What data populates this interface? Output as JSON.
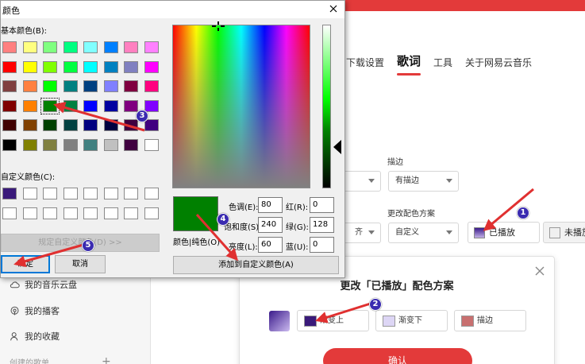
{
  "app": {
    "nav_tabs": [
      "下载设置",
      "歌词",
      "工具",
      "关于网易云音乐"
    ],
    "active_tab": "歌词",
    "stroke_label": "描边",
    "stroke_value": "有描边",
    "scheme_label": "更改配色方案",
    "scheme_value": "自定义",
    "played_label": "已播放",
    "unplayed_label": "未播放",
    "sidebar_items": [
      "我的音乐云盘",
      "我的播客",
      "我的收藏",
      "创建的歌单"
    ],
    "scheme_dialog": {
      "title": "更改「已播放」配色方案",
      "gradient_top": "渐变上",
      "gradient_bottom": "渐变下",
      "stroke": "描边",
      "confirm": "确认"
    }
  },
  "color_dialog": {
    "title": "颜色",
    "basic_label": "基本颜色(B):",
    "custom_label": "自定义颜色(C):",
    "define_custom_btn": "规定自定义颜色(D) >>",
    "ok_btn": "确定",
    "cancel_btn": "取消",
    "add_custom_btn": "添加到自定义颜色(A)",
    "preview_label": "颜色|纯色(O)",
    "fields": {
      "hue_label": "色调(E):",
      "hue": "80",
      "sat_label": "饱和度(S):",
      "sat": "240",
      "lum_label": "亮度(L):",
      "lum": "60",
      "red_label": "红(R):",
      "red": "0",
      "green_label": "绿(G):",
      "green": "128",
      "blue_label": "蓝(U):",
      "blue": "0"
    },
    "basic_colors": [
      [
        "#ff8080",
        "#ffff80",
        "#80ff80",
        "#00ff80",
        "#80ffff",
        "#0080ff",
        "#ff80c0",
        "#ff80ff"
      ],
      [
        "#ff0000",
        "#ffff00",
        "#80ff00",
        "#00ff40",
        "#00ffff",
        "#0080c0",
        "#8080c0",
        "#ff00ff"
      ],
      [
        "#804040",
        "#ff8040",
        "#00ff00",
        "#008080",
        "#004080",
        "#8080ff",
        "#800040",
        "#ff0080"
      ],
      [
        "#800000",
        "#ff8000",
        "#008000",
        "#008040",
        "#0000ff",
        "#0000a0",
        "#800080",
        "#8000ff"
      ],
      [
        "#400000",
        "#804000",
        "#004000",
        "#004040",
        "#000080",
        "#000040",
        "#400040",
        "#400080"
      ],
      [
        "#000000",
        "#808000",
        "#808040",
        "#808080",
        "#408080",
        "#c0c0c0",
        "#400040",
        "#ffffff"
      ]
    ],
    "selected_basic": [
      3,
      2
    ],
    "custom_colors": [
      [
        "#3a1a7a",
        "#ffffff",
        "#ffffff",
        "#ffffff",
        "#ffffff",
        "#ffffff",
        "#ffffff",
        "#ffffff"
      ],
      [
        "#ffffff",
        "#ffffff",
        "#ffffff",
        "#ffffff",
        "#ffffff",
        "#ffffff",
        "#ffffff",
        "#ffffff"
      ]
    ],
    "preview_color": "#008000"
  },
  "annotations": {
    "color": "#e03030",
    "badges": [
      "1",
      "2",
      "3",
      "4",
      "5"
    ]
  }
}
